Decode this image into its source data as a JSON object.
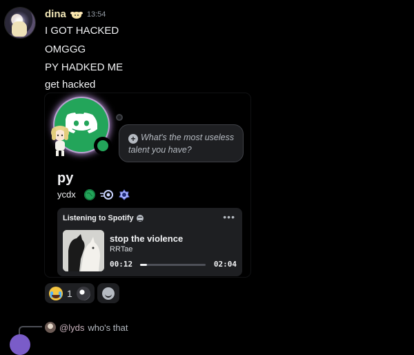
{
  "message": {
    "username": "dina",
    "timestamp": "13:54",
    "username_color": "#f1e6b7",
    "lines": [
      "I GOT HACKED",
      "OMGGG",
      "PY HADKED ME",
      "get hacked"
    ]
  },
  "profile_card": {
    "avatar_icon": "discord-logo-icon",
    "avatar_color": "#23a55a",
    "status": "online",
    "prompt": "What's the most useless talent you have?",
    "display_name": "py",
    "handle": "ycdx",
    "badges": [
      "globe-badge-icon",
      "nitro-badge-icon",
      "boost-badge-icon"
    ],
    "activity": {
      "header": "Listening to Spotify",
      "more": "•••",
      "track": "stop the violence",
      "artist": "RRTae",
      "elapsed": "00:12",
      "duration": "02:04",
      "progress_fraction": 0.1
    }
  },
  "reactions": [
    {
      "emoji": "loudly-crying-face",
      "count": "1"
    },
    {
      "emoji": "user-avatar-reaction",
      "count": ""
    }
  ],
  "reply_preview": {
    "user": "@lyds",
    "text": "who's that"
  }
}
